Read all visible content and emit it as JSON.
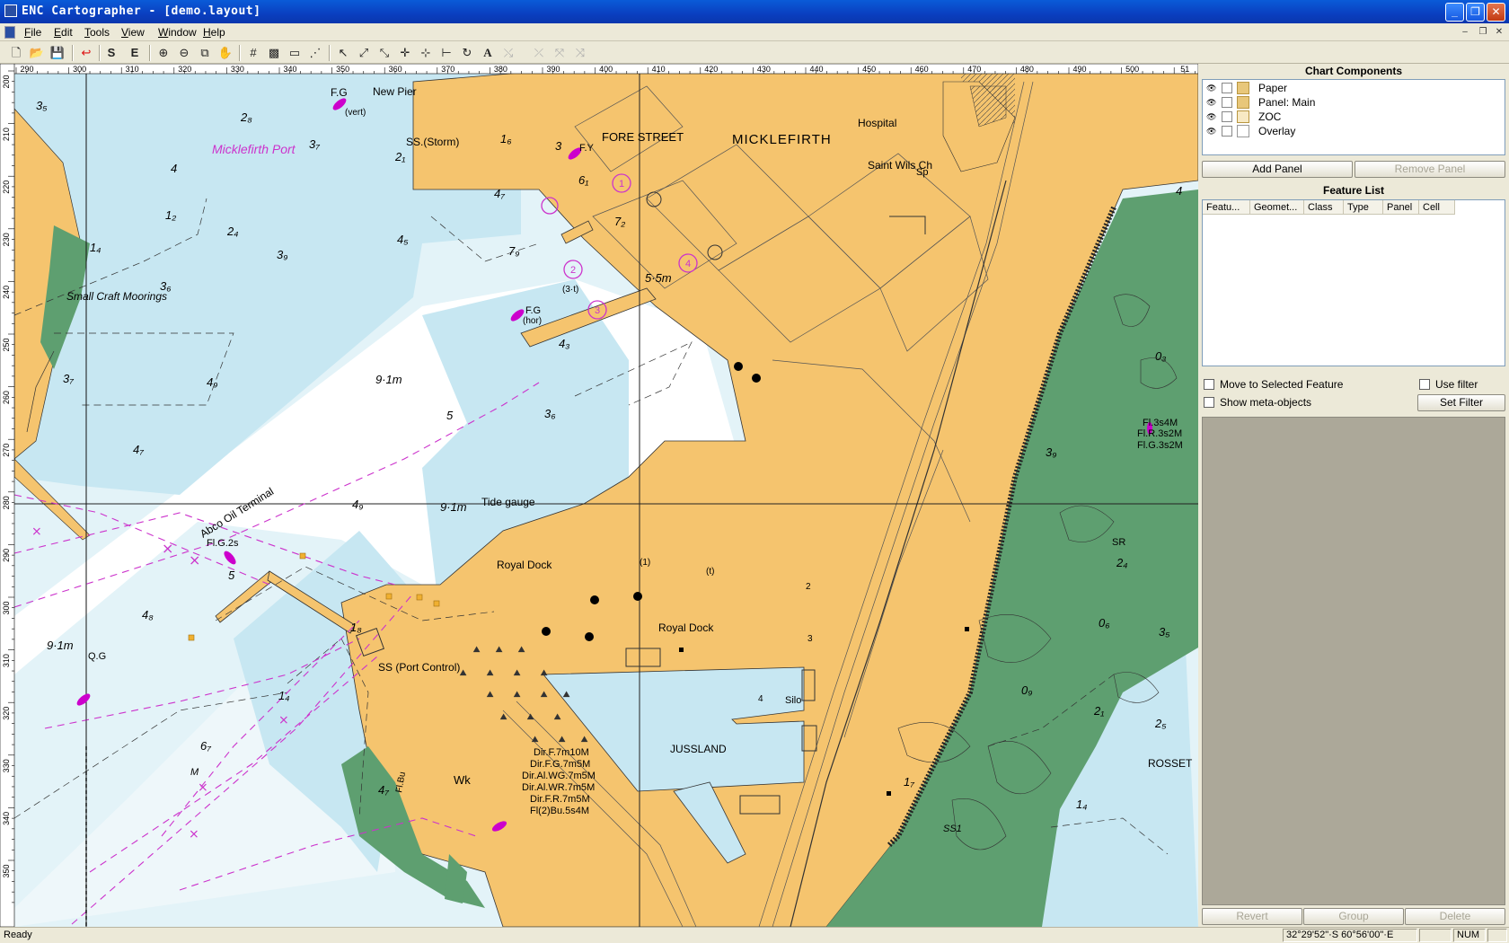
{
  "window": {
    "title": "ENC Cartographer - [demo.layout]"
  },
  "menu": [
    "File",
    "Edit",
    "Tools",
    "View",
    "Window",
    "Help"
  ],
  "toolbar": {
    "icons": [
      "new-file-icon",
      "open-folder-icon",
      "save-icon",
      "undo-icon",
      "s-tool",
      "e-tool",
      "zoom-in-icon",
      "zoom-out-icon",
      "zoom-window-icon",
      "pan-hand-icon",
      "grid-icon",
      "pattern-icon",
      "measure-icon",
      "scale-icon",
      "select-arrow-icon",
      "edit-line-icon",
      "edit-vertex-icon",
      "add-point-icon",
      "add-vertex-icon",
      "split-icon",
      "rotate-icon",
      "text-icon",
      "disabled-tool-1-icon",
      "disabled-tool-2-icon",
      "disabled-tool-3-icon",
      "disabled-tool-4-icon"
    ],
    "s_label": "S",
    "e_label": "E",
    "text_label": "A"
  },
  "chart": {
    "top_ruler_labels": [
      "290",
      "300",
      "310",
      "320",
      "330",
      "340",
      "350",
      "360",
      "370",
      "380",
      "390",
      "400",
      "410",
      "420",
      "430",
      "440",
      "450",
      "460",
      "470",
      "480",
      "490",
      "500",
      "51"
    ],
    "left_ruler_labels": [
      "200",
      "210",
      "220",
      "230",
      "240",
      "250",
      "260",
      "270",
      "280",
      "290",
      "300",
      "310",
      "320",
      "330",
      "340",
      "350"
    ],
    "labels": {
      "micklefirth_port": "Micklefirth Port",
      "new_pier": "New Pier",
      "fg_newpier": "F.G",
      "vert": "(vert)",
      "ss_storm": "SS.(Storm)",
      "fore_street": "FORE STREET",
      "micklefirth": "MICKLEFIRTH",
      "hospital": "Hospital",
      "saint_wils": "Saint Wils Ch",
      "sp": "Sp",
      "fy": "F.Y",
      "small_craft": "Small Craft Moorings",
      "depth_55": "5·5m",
      "depth_91_a": "9·1m",
      "depth_91_b": "9·1m",
      "depth_91_c": "9·1m",
      "fg_hor": "F.G",
      "hor": "(hor)",
      "three_t": "(3·t)",
      "abco": "Abco Oil Terminal",
      "flg2s": "Fl.G.2s",
      "tide_gauge": "Tide gauge",
      "royal_dock_a": "Royal Dock",
      "royal_dock_b": "Royal Dock",
      "ss_port": "SS (Port Control)",
      "qg": "Q.G",
      "silo": "Silo",
      "jussland": "JUSSLAND",
      "rosset": "ROSSET",
      "wk": "Wk",
      "flbu": "Fl.Bu",
      "lt1": "Fl.3s4M",
      "lt2": "Fl.R.3s2M",
      "lt3": "Fl.G.3s2M",
      "dir1": "Dir.F.7m10M",
      "dir2": "Dir.F.G.7m5M",
      "dir3": "Dir.Al.WG.7m5M",
      "dir4": "Dir.Al.WR.7m5M",
      "dir5": "Dir.F.R.7m5M",
      "dir6": "Fl(2)Bu.5s4M",
      "sr": "SR",
      "one_t": "(1)",
      "one_t2": "(t)",
      "box2": "2",
      "box3": "3",
      "box4": "4",
      "box1": "1",
      "m": "M",
      "ss1": "SS1"
    },
    "soundings": [
      {
        "t": "3₅"
      },
      {
        "t": "2₈"
      },
      {
        "t": "3₇"
      },
      {
        "t": "2₁"
      },
      {
        "t": "1₆"
      },
      {
        "t": "3"
      },
      {
        "t": "6₁"
      },
      {
        "t": "4"
      },
      {
        "t": "1₂"
      },
      {
        "t": "1₄"
      },
      {
        "t": "2₄"
      },
      {
        "t": "3₉"
      },
      {
        "t": "4₅"
      },
      {
        "t": "4₇"
      },
      {
        "t": "7₂"
      },
      {
        "t": "7₉"
      },
      {
        "t": "3₆"
      },
      {
        "t": "3₇"
      },
      {
        "t": "4₉"
      },
      {
        "t": "4₃"
      },
      {
        "t": "5"
      },
      {
        "t": "3₆"
      },
      {
        "t": "4₇"
      },
      {
        "t": "4₉"
      },
      {
        "t": "5"
      },
      {
        "t": "4₈"
      },
      {
        "t": "1₈"
      },
      {
        "t": "1₄"
      },
      {
        "t": "6₇"
      },
      {
        "t": "4₇"
      },
      {
        "t": "3₉"
      },
      {
        "t": "0₃"
      },
      {
        "t": "2₄"
      },
      {
        "t": "0₆"
      },
      {
        "t": "3₅"
      },
      {
        "t": "0₉"
      },
      {
        "t": "2₁"
      },
      {
        "t": "2₅"
      },
      {
        "t": "1₇"
      },
      {
        "t": "1₄"
      },
      {
        "t": "4"
      }
    ],
    "lights_numbered": [
      "1",
      "2",
      "3",
      "4"
    ]
  },
  "chart_components": {
    "header": "Chart Components",
    "items": [
      {
        "label": "Paper"
      },
      {
        "label": "Panel: Main"
      },
      {
        "label": "ZOC"
      },
      {
        "label": "Overlay"
      }
    ],
    "add_panel": "Add Panel",
    "remove_panel": "Remove Panel"
  },
  "feature_list": {
    "header": "Feature List",
    "columns": [
      "Featu...",
      "Geomet...",
      "Class",
      "Type",
      "Panel",
      "Cell"
    ],
    "move_to_selected": "Move to Selected Feature",
    "use_filter": "Use filter",
    "show_meta": "Show meta-objects",
    "set_filter": "Set Filter",
    "revert": "Revert",
    "group": "Group",
    "delete": "Delete"
  },
  "status": {
    "text": "Ready",
    "coords": "32°29'52\"·S 60°56'00\"·E",
    "num": "NUM"
  },
  "colors": {
    "land": "#f5c46e",
    "shallow": "#c7e7f2",
    "medium": "#e3f3f8",
    "deep": "#ffffff",
    "intertidal": "#5e9f70",
    "magenta": "#cc33cc"
  }
}
